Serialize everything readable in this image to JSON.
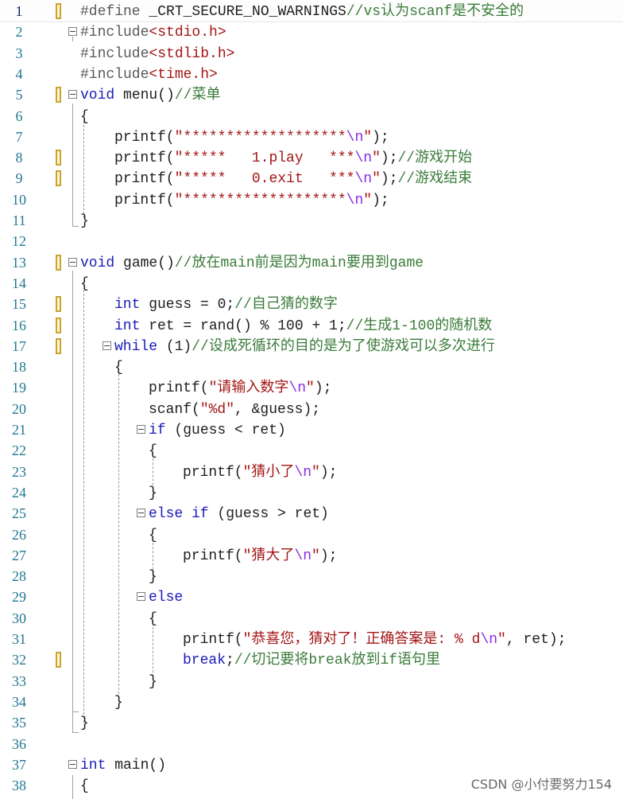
{
  "editor": {
    "lines": [
      {
        "n": "1",
        "mark": true,
        "fold": false,
        "indent": 0,
        "segs": [
          [
            "pp",
            "#define "
          ],
          [
            "fn",
            "_CRT_SECURE_NO_WARNINGS"
          ],
          [
            "cmt",
            "//vs认为scanf是不安全的"
          ]
        ]
      },
      {
        "n": "2",
        "mark": false,
        "fold": true,
        "indent": 0,
        "segs": [
          [
            "pp",
            "#include"
          ],
          [
            "str",
            "<stdio.h>"
          ]
        ]
      },
      {
        "n": "3",
        "mark": false,
        "fold": false,
        "indent": 0,
        "segs": [
          [
            "pp",
            "#include"
          ],
          [
            "str",
            "<stdlib.h>"
          ]
        ]
      },
      {
        "n": "4",
        "mark": false,
        "fold": false,
        "indent": 0,
        "segs": [
          [
            "pp",
            "#include"
          ],
          [
            "str",
            "<time.h>"
          ]
        ]
      },
      {
        "n": "5",
        "mark": true,
        "fold": true,
        "indent": 0,
        "segs": [
          [
            "kw",
            "void"
          ],
          [
            "fn",
            " menu()"
          ],
          [
            "cmt",
            "//菜单"
          ]
        ]
      },
      {
        "n": "6",
        "mark": false,
        "fold": false,
        "indent": 0,
        "segs": [
          [
            "fn",
            "{"
          ]
        ]
      },
      {
        "n": "7",
        "mark": false,
        "fold": false,
        "indent": 1,
        "segs": [
          [
            "fn",
            "printf("
          ],
          [
            "str",
            "\"*******************"
          ],
          [
            "esc",
            "\\n"
          ],
          [
            "str",
            "\""
          ],
          [
            "fn",
            ");"
          ]
        ]
      },
      {
        "n": "8",
        "mark": true,
        "fold": false,
        "indent": 1,
        "segs": [
          [
            "fn",
            "printf("
          ],
          [
            "str",
            "\"*****   1.play   ***"
          ],
          [
            "esc",
            "\\n"
          ],
          [
            "str",
            "\""
          ],
          [
            "fn",
            ");"
          ],
          [
            "cmt",
            "//游戏开始"
          ]
        ]
      },
      {
        "n": "9",
        "mark": true,
        "fold": false,
        "indent": 1,
        "segs": [
          [
            "fn",
            "printf("
          ],
          [
            "str",
            "\"*****   0.exit   ***"
          ],
          [
            "esc",
            "\\n"
          ],
          [
            "str",
            "\""
          ],
          [
            "fn",
            ");"
          ],
          [
            "cmt",
            "//游戏结束"
          ]
        ]
      },
      {
        "n": "10",
        "mark": false,
        "fold": false,
        "indent": 1,
        "segs": [
          [
            "fn",
            "printf("
          ],
          [
            "str",
            "\"*******************"
          ],
          [
            "esc",
            "\\n"
          ],
          [
            "str",
            "\""
          ],
          [
            "fn",
            ");"
          ]
        ]
      },
      {
        "n": "11",
        "mark": false,
        "fold": false,
        "indent": 0,
        "segs": [
          [
            "fn",
            "}"
          ]
        ]
      },
      {
        "n": "12",
        "mark": false,
        "fold": false,
        "indent": 0,
        "segs": []
      },
      {
        "n": "13",
        "mark": true,
        "fold": true,
        "indent": 0,
        "segs": [
          [
            "kw",
            "void"
          ],
          [
            "fn",
            " game()"
          ],
          [
            "cmt",
            "//放在main前是因为main要用到game"
          ]
        ]
      },
      {
        "n": "14",
        "mark": false,
        "fold": false,
        "indent": 0,
        "segs": [
          [
            "fn",
            "{"
          ]
        ]
      },
      {
        "n": "15",
        "mark": true,
        "fold": false,
        "indent": 1,
        "segs": [
          [
            "kw",
            "int"
          ],
          [
            "fn",
            " guess = 0;"
          ],
          [
            "cmt",
            "//自己猜的数字"
          ]
        ]
      },
      {
        "n": "16",
        "mark": true,
        "fold": false,
        "indent": 1,
        "segs": [
          [
            "kw",
            "int"
          ],
          [
            "fn",
            " ret = rand() % 100 + 1;"
          ],
          [
            "cmt",
            "//生成1-100的随机数"
          ]
        ]
      },
      {
        "n": "17",
        "mark": true,
        "fold": true,
        "indent": 1,
        "segs": [
          [
            "kw",
            "while"
          ],
          [
            "fn",
            " (1)"
          ],
          [
            "cmt",
            "//设成死循环的目的是为了使游戏可以多次进行"
          ]
        ]
      },
      {
        "n": "18",
        "mark": false,
        "fold": false,
        "indent": 1,
        "segs": [
          [
            "fn",
            "{"
          ]
        ]
      },
      {
        "n": "19",
        "mark": false,
        "fold": false,
        "indent": 2,
        "segs": [
          [
            "fn",
            "printf("
          ],
          [
            "str",
            "\"请输入数字"
          ],
          [
            "esc",
            "\\n"
          ],
          [
            "str",
            "\""
          ],
          [
            "fn",
            ");"
          ]
        ]
      },
      {
        "n": "20",
        "mark": false,
        "fold": false,
        "indent": 2,
        "segs": [
          [
            "fn",
            "scanf("
          ],
          [
            "str",
            "\"%d\""
          ],
          [
            "fn",
            ", &guess);"
          ]
        ]
      },
      {
        "n": "21",
        "mark": false,
        "fold": true,
        "indent": 2,
        "segs": [
          [
            "kw",
            "if"
          ],
          [
            "fn",
            " (guess < ret)"
          ]
        ]
      },
      {
        "n": "22",
        "mark": false,
        "fold": false,
        "indent": 2,
        "segs": [
          [
            "fn",
            "{"
          ]
        ]
      },
      {
        "n": "23",
        "mark": false,
        "fold": false,
        "indent": 3,
        "segs": [
          [
            "fn",
            "printf("
          ],
          [
            "str",
            "\"猜小了"
          ],
          [
            "esc",
            "\\n"
          ],
          [
            "str",
            "\""
          ],
          [
            "fn",
            ");"
          ]
        ]
      },
      {
        "n": "24",
        "mark": false,
        "fold": false,
        "indent": 2,
        "segs": [
          [
            "fn",
            "}"
          ]
        ]
      },
      {
        "n": "25",
        "mark": false,
        "fold": true,
        "indent": 2,
        "segs": [
          [
            "kw",
            "else if"
          ],
          [
            "fn",
            " (guess > ret)"
          ]
        ]
      },
      {
        "n": "26",
        "mark": false,
        "fold": false,
        "indent": 2,
        "segs": [
          [
            "fn",
            "{"
          ]
        ]
      },
      {
        "n": "27",
        "mark": false,
        "fold": false,
        "indent": 3,
        "segs": [
          [
            "fn",
            "printf("
          ],
          [
            "str",
            "\"猜大了"
          ],
          [
            "esc",
            "\\n"
          ],
          [
            "str",
            "\""
          ],
          [
            "fn",
            ");"
          ]
        ]
      },
      {
        "n": "28",
        "mark": false,
        "fold": false,
        "indent": 2,
        "segs": [
          [
            "fn",
            "}"
          ]
        ]
      },
      {
        "n": "29",
        "mark": false,
        "fold": true,
        "indent": 2,
        "segs": [
          [
            "kw",
            "else"
          ]
        ]
      },
      {
        "n": "30",
        "mark": false,
        "fold": false,
        "indent": 2,
        "segs": [
          [
            "fn",
            "{"
          ]
        ]
      },
      {
        "n": "31",
        "mark": false,
        "fold": false,
        "indent": 3,
        "segs": [
          [
            "fn",
            "printf("
          ],
          [
            "str",
            "\"恭喜您，猜对了！正确答案是: % d"
          ],
          [
            "esc",
            "\\n"
          ],
          [
            "str",
            "\""
          ],
          [
            "fn",
            ", ret);"
          ]
        ]
      },
      {
        "n": "32",
        "mark": true,
        "fold": false,
        "indent": 3,
        "segs": [
          [
            "kw",
            "break"
          ],
          [
            "fn",
            ";"
          ],
          [
            "cmt",
            "//切记要将break放到if语句里"
          ]
        ]
      },
      {
        "n": "33",
        "mark": false,
        "fold": false,
        "indent": 2,
        "segs": [
          [
            "fn",
            "}"
          ]
        ]
      },
      {
        "n": "34",
        "mark": false,
        "fold": false,
        "indent": 1,
        "segs": [
          [
            "fn",
            "}"
          ]
        ]
      },
      {
        "n": "35",
        "mark": false,
        "fold": false,
        "indent": 0,
        "segs": [
          [
            "fn",
            "}"
          ]
        ]
      },
      {
        "n": "36",
        "mark": false,
        "fold": false,
        "indent": 0,
        "segs": []
      },
      {
        "n": "37",
        "mark": false,
        "fold": true,
        "indent": 0,
        "segs": [
          [
            "kw",
            "int"
          ],
          [
            "fn",
            " main()"
          ]
        ]
      },
      {
        "n": "38",
        "mark": false,
        "fold": false,
        "indent": 0,
        "segs": [
          [
            "fn",
            "{"
          ]
        ]
      }
    ],
    "current_line": "1"
  },
  "watermark": "CSDN @小付要努力154"
}
